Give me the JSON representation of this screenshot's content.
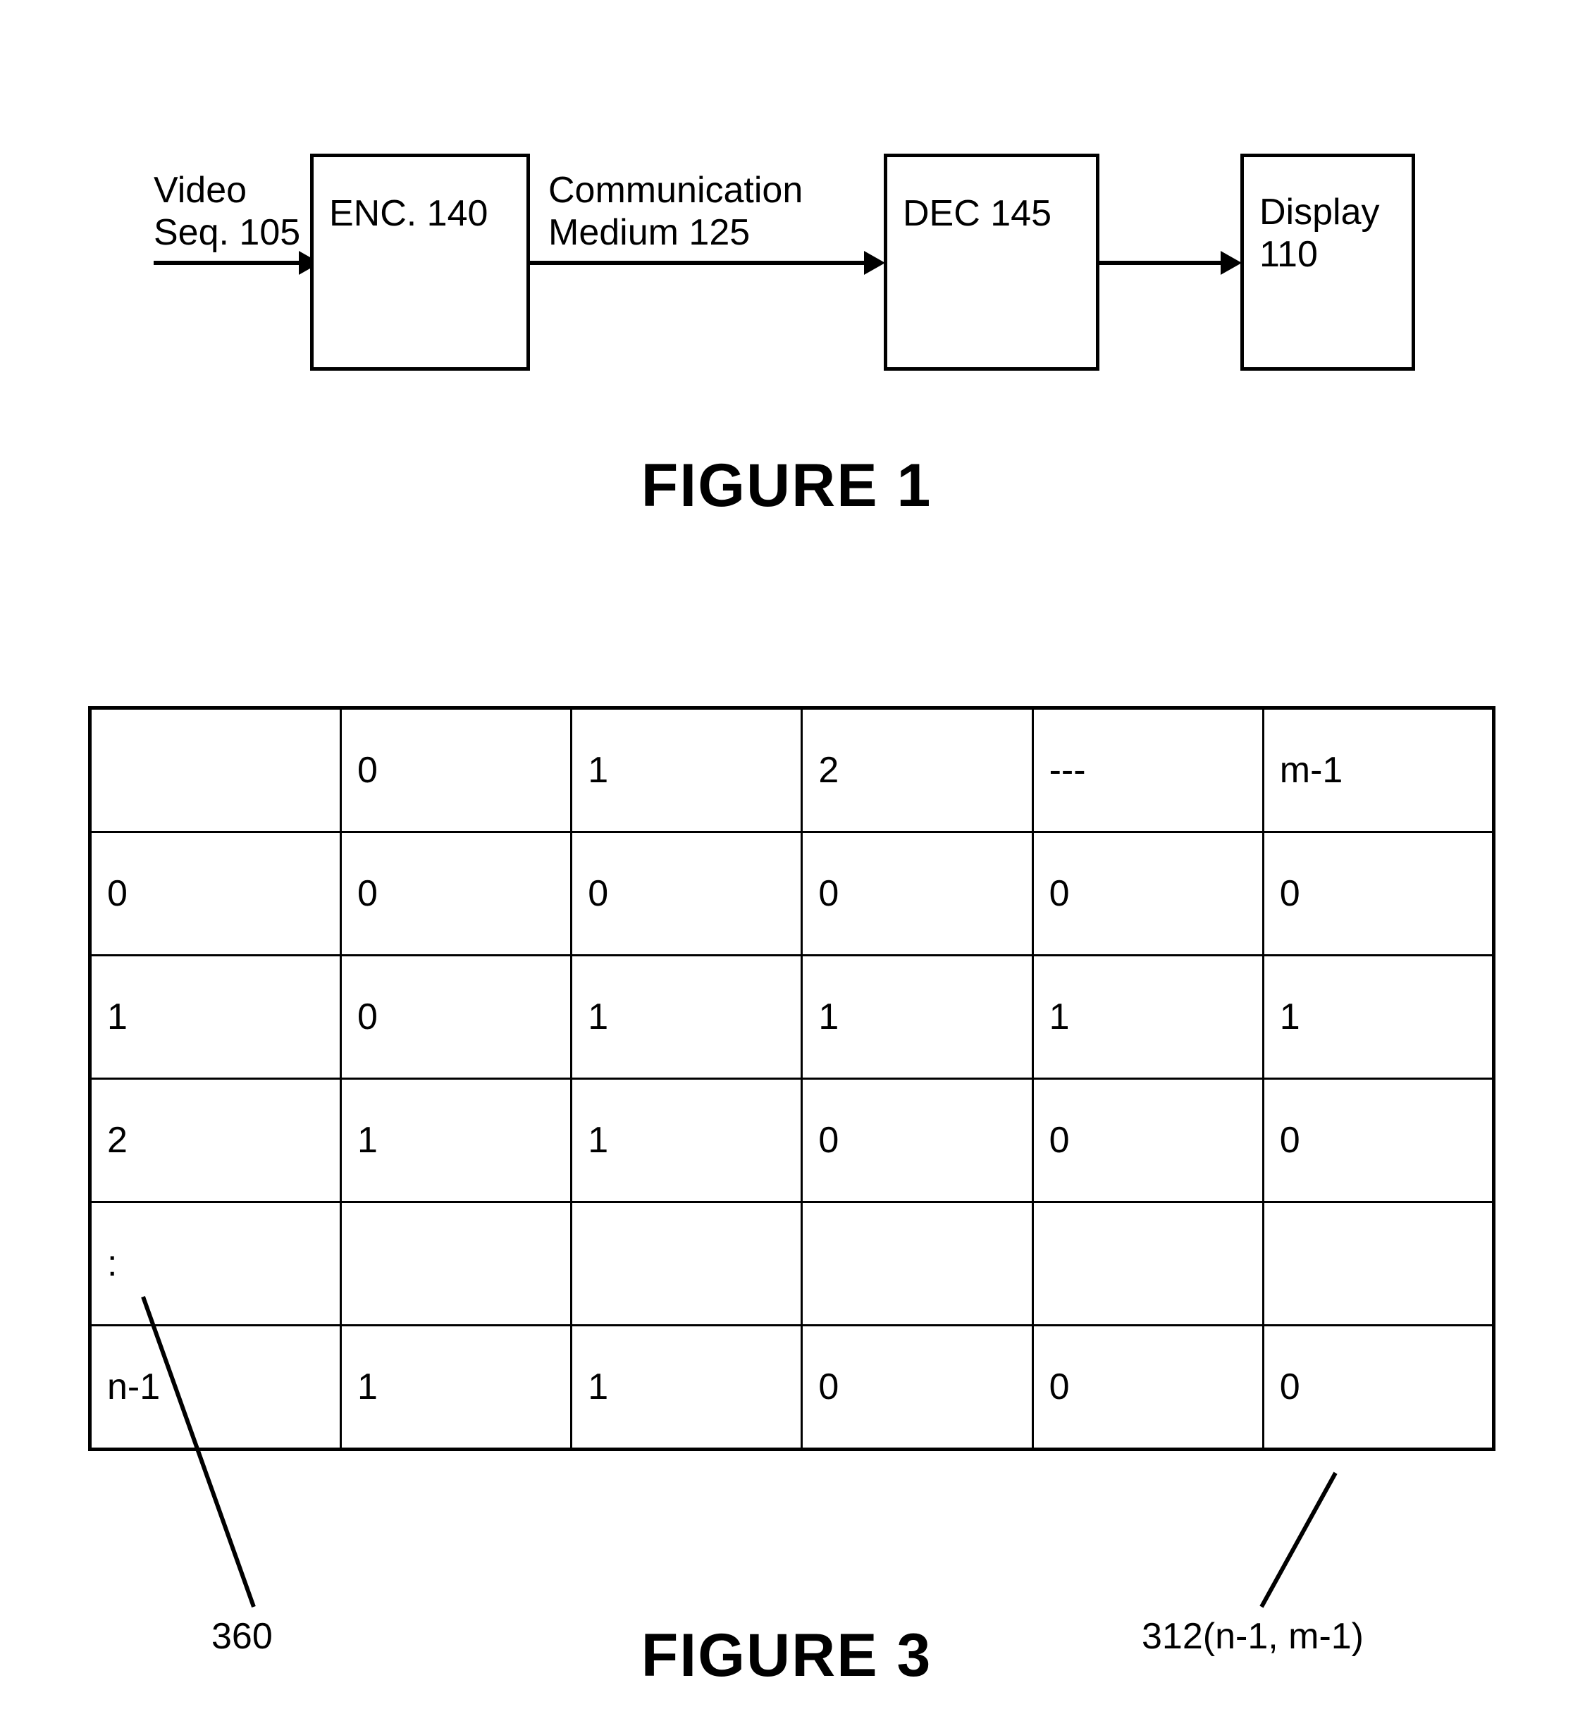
{
  "figure1": {
    "caption": "FIGURE 1",
    "input_label": "Video\nSeq. 105",
    "medium_label": "Communication\nMedium 125",
    "blocks": [
      {
        "id": "encoder",
        "label": "ENC. 140"
      },
      {
        "id": "decoder",
        "label": "DEC 145"
      },
      {
        "id": "display",
        "label": "Display\n110"
      }
    ]
  },
  "figure3": {
    "caption": "FIGURE 3",
    "table": {
      "corner_label": "",
      "column_headers": [
        "0",
        "1",
        "2",
        "---",
        "m-1"
      ],
      "row_headers": [
        "0",
        "1",
        "2",
        ":",
        "n-1"
      ],
      "rows": [
        [
          "0",
          "0",
          "0",
          "0",
          "0"
        ],
        [
          "0",
          "1",
          "1",
          "1",
          "1"
        ],
        [
          "1",
          "1",
          "0",
          "0",
          "0"
        ],
        [
          "",
          "",
          "",
          "",
          ""
        ],
        [
          "1",
          "1",
          "0",
          "0",
          "0"
        ]
      ]
    },
    "reference_labels": [
      {
        "id": "matrix-ref",
        "text": "360"
      },
      {
        "id": "cell-ref",
        "text": "312(n-1, m-1)"
      }
    ]
  }
}
